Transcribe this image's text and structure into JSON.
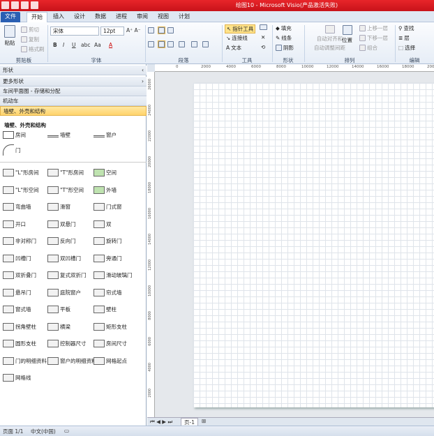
{
  "title": "绘图10 - Microsoft Visio(产品激活失败)",
  "tabs": [
    "文件",
    "开始",
    "插入",
    "设计",
    "数据",
    "进程",
    "审阅",
    "视图",
    "计划"
  ],
  "ribbon": {
    "clipboard": {
      "paste": "粘贴",
      "cut": "剪切",
      "copy": "复制",
      "format_painter": "格式刷",
      "label": "剪贴板"
    },
    "font": {
      "family": "宋体",
      "size": "12pt",
      "label": "字体",
      "bold": "B",
      "italic": "I",
      "underline": "U",
      "abc": "abc",
      "aa": "Aa",
      "color": "A"
    },
    "paragraph": {
      "label": "段落"
    },
    "tools": {
      "pointer": "指针工具",
      "connector": "连接线",
      "text": "文本",
      "label": "工具"
    },
    "shape": {
      "fill": "填充",
      "line": "线条",
      "shadow": "阴影",
      "label": "形状"
    },
    "arrange": {
      "align": "自动对齐和",
      "spacing": "自动调整间距",
      "position": "位置",
      "bring_front": "上移一层",
      "send_back": "下移一层",
      "group": "组合",
      "label": "排列"
    },
    "editing": {
      "find": "查找",
      "layer": "层",
      "select": "选择",
      "label": "编辑"
    }
  },
  "shapes_pane": {
    "header": "形状",
    "more_shapes": "更多形状",
    "stencils": [
      "车间平面图 - 存储和分配",
      "机动车",
      "墙壁、外壳和结构"
    ],
    "quick_title": "墙壁、外壳和结构",
    "quick": [
      "房间",
      "墙壁",
      "窗户",
      "门"
    ],
    "items": [
      [
        "\"L\"形房间",
        "\"T\"形房间",
        "空间"
      ],
      [
        "\"L\"形空间",
        "\"T\"形空间",
        "外墙"
      ],
      [
        "弯曲墙",
        "滑窗",
        "门式窗"
      ],
      [
        "开口",
        "双悬门",
        "双"
      ],
      [
        "非对称门",
        "反向门",
        "旋转门"
      ],
      [
        "凹槽门",
        "双凹槽门",
        "旁通门"
      ],
      [
        "双折叠门",
        "复式双折门",
        "滑动玻璃门"
      ],
      [
        "悬吊门",
        "庭院窗户",
        "帘式墙"
      ],
      [
        "窗式墙",
        "平板",
        "壁柱"
      ],
      [
        "拐角壁柱",
        "横梁",
        "矩形支柱"
      ],
      [
        "圆形支柱",
        "控制器尺寸",
        "房间尺寸"
      ],
      [
        "门的明细资料",
        "窗户的明细资料",
        "网格起点"
      ],
      [
        "网格线"
      ]
    ]
  },
  "ruler_h": [
    "0",
    "2000",
    "4000",
    "6000",
    "8000",
    "10000",
    "12000",
    "14000",
    "16000",
    "18000",
    "20000"
  ],
  "ruler_v": [
    "26000",
    "24000",
    "22000",
    "20000",
    "18000",
    "16000",
    "14000",
    "12000",
    "10000",
    "8000",
    "6000",
    "4000",
    "2000"
  ],
  "page_tab": "页-1",
  "status": {
    "page": "页面 1/1",
    "lang": "中文(中国)"
  },
  "colors": {
    "titlebar": "#d41d22",
    "file_tab": "#2a5fb3",
    "highlight": "#ffd36c"
  }
}
